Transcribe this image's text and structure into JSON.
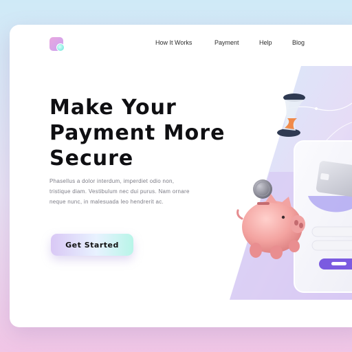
{
  "nav": {
    "items": [
      "How It Works",
      "Payment",
      "Help",
      "Blog"
    ]
  },
  "hero": {
    "title_lines": [
      "Make Your",
      "Payment More",
      "Secure"
    ],
    "description_lines": [
      "Phasellus a dolor interdum, imperdiet odio non,",
      "tristique diam. Vestibulum nec dui purus. Nam ornare",
      "neque nunc, in malesuada leo hendrerit ac."
    ],
    "cta_label": "Get Started"
  },
  "colors": {
    "accent": "#7b5be0",
    "piggy": "#f2a0a0",
    "text": "#0f0f12"
  },
  "icons": [
    "logo-icon",
    "hourglass-icon",
    "coin-icon",
    "piggy-bank-icon",
    "credit-card-icon"
  ]
}
